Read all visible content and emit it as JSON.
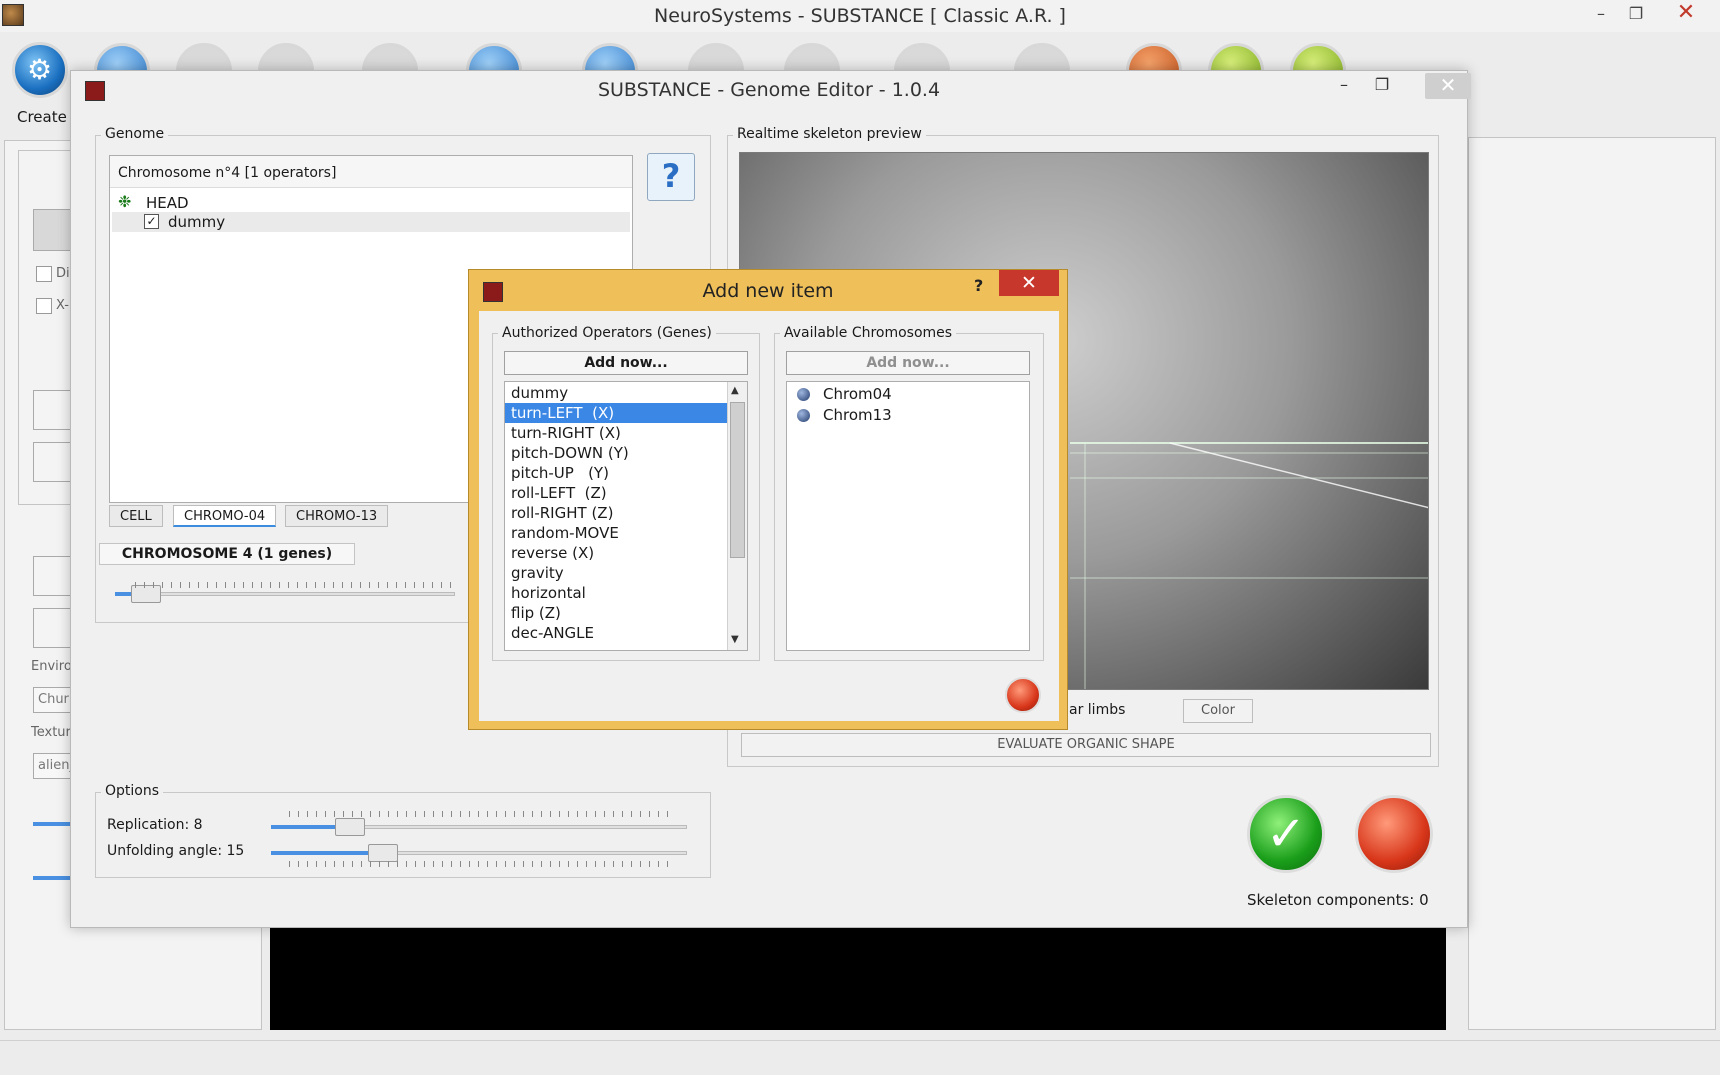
{
  "main": {
    "title": "NeuroSystems - SUBSTANCE  [ Classic A.R. ]",
    "create_label": "Create",
    "minimize": "–",
    "restore": "❐",
    "close": "✕",
    "left_panel": {
      "check1": "Di",
      "check2": "X-",
      "environ_label": "Enviro",
      "environ_value": "Chur",
      "texture_label": "Textur",
      "texture_value": "alien_"
    }
  },
  "editor": {
    "title": "SUBSTANCE - Genome Editor - 1.0.4",
    "genome_legend": "Genome",
    "tree_header": "Chromosome n°4 [1 operators]",
    "tree_root": "HEAD",
    "tree_child": "dummy",
    "help_glyph": "?",
    "tabs": [
      "CELL",
      "CHROMO-04",
      "CHROMO-13"
    ],
    "chromosome_label": "CHROMOSOME 4  (1 genes)",
    "preview_legend": "Realtime skeleton preview",
    "limbs_text": "ar limbs",
    "color_button": "Color",
    "evaluate_button": "EVALUATE ORGANIC SHAPE",
    "options_legend": "Options",
    "replication_label": "Replication: 8",
    "unfolding_label": "Unfolding angle: 15",
    "skeleton_components": "Skeleton components: 0",
    "replication_fraction": 0.19,
    "unfolding_fraction": 0.27
  },
  "dialog": {
    "title": "Add new item",
    "help": "?",
    "close": "✕",
    "operators_legend": "Authorized Operators (Genes)",
    "chromosomes_legend": "Available Chromosomes",
    "add_now": "Add now...",
    "add_now_disabled": "Add now...",
    "operators": [
      "dummy",
      "turn-LEFT  (X)",
      "turn-RIGHT (X)",
      "pitch-DOWN (Y)",
      "pitch-UP   (Y)",
      "roll-LEFT  (Z)",
      "roll-RIGHT (Z)",
      "random-MOVE",
      "reverse (X)",
      "gravity",
      "horizontal",
      "flip (Z)",
      "dec-ANGLE"
    ],
    "selected_operator_index": 1,
    "chromosomes": [
      "Chrom04",
      "Chrom13"
    ]
  },
  "colors": {
    "dialog_frame": "#efc05a",
    "selection": "#3a87e6",
    "close_red": "#c8372b"
  }
}
